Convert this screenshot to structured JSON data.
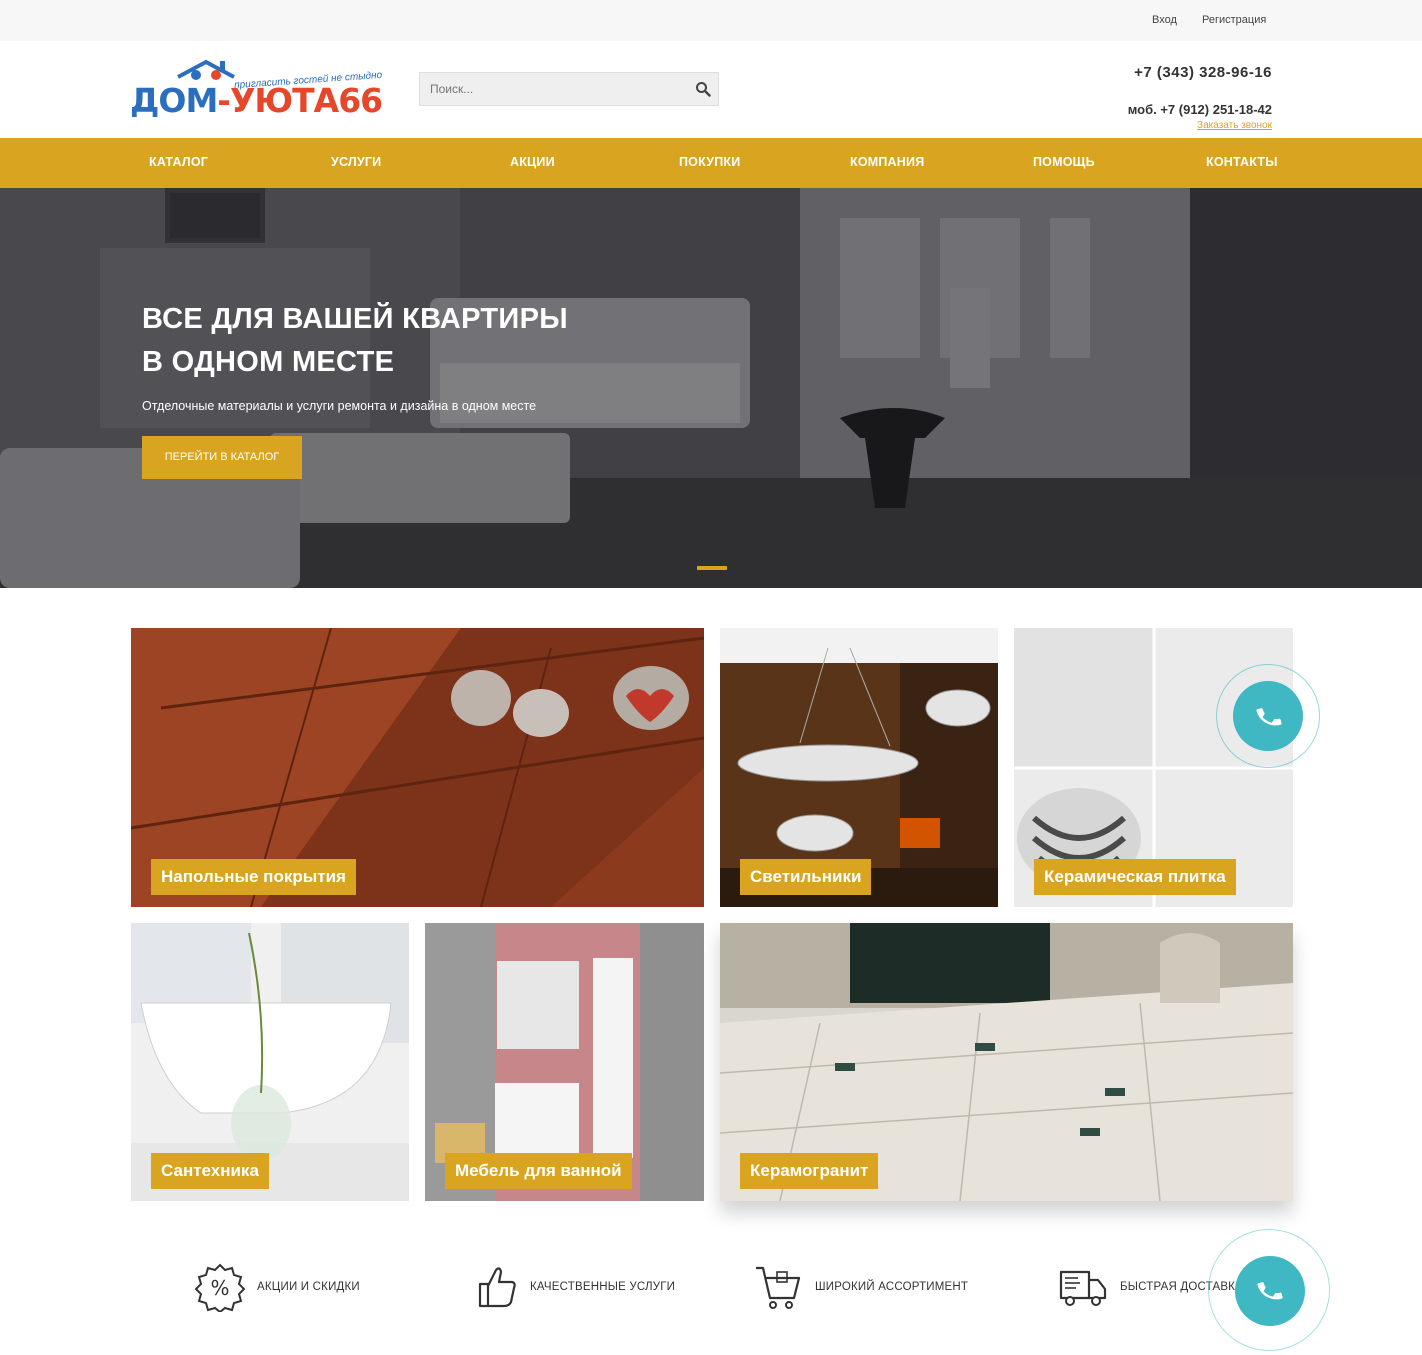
{
  "topbar": {
    "login": "Вход",
    "register": "Регистрация"
  },
  "header": {
    "logo_text_a": "ДОМ",
    "logo_text_b": "-УЮТА66",
    "logo_tagline": "пригласить гостей не стыдно",
    "search_placeholder": "Поиск...",
    "phone_main": "+7 (343) 328-96-16",
    "phone_mobile": "моб. +7 (912) 251-18-42",
    "callback_link": "Заказать звонок"
  },
  "nav": {
    "items": [
      {
        "label": "КАТАЛОГ"
      },
      {
        "label": "УСЛУГИ"
      },
      {
        "label": "АКЦИИ"
      },
      {
        "label": "ПОКУПКИ"
      },
      {
        "label": "КОМПАНИЯ"
      },
      {
        "label": "ПОМОЩЬ"
      },
      {
        "label": "КОНТАКТЫ"
      }
    ]
  },
  "hero": {
    "title_line1": "ВСЕ ДЛЯ ВАШЕЙ КВАРТИРЫ",
    "title_line2": "В ОДНОМ МЕСТЕ",
    "subtitle": "Отделочные материалы и услуги ремонта и дизайна в одном месте",
    "button": "ПЕРЕЙТИ В КАТАЛОГ"
  },
  "categories": [
    {
      "label": "Напольные покрытия"
    },
    {
      "label": "Светильники"
    },
    {
      "label": "Керамическая плитка"
    },
    {
      "label": "Сантехника"
    },
    {
      "label": "Мебель для ванной"
    },
    {
      "label": "Керамогранит"
    }
  ],
  "features": [
    {
      "label": "АКЦИИ И СКИДКИ",
      "icon": "percent-badge-icon"
    },
    {
      "label": "КАЧЕСТВЕННЫЕ УСЛУГИ",
      "icon": "thumbs-up-icon"
    },
    {
      "label": "ШИРОКИЙ АССОРТИМЕНТ",
      "icon": "shopping-cart-icon"
    },
    {
      "label": "БЫСТРАЯ ДОСТАВКА",
      "icon": "delivery-truck-icon"
    }
  ],
  "colors": {
    "accent": "#d9a520",
    "call_widget": "#3fb8c4",
    "logo_blue": "#2a6ebd",
    "logo_red": "#e6472a"
  }
}
